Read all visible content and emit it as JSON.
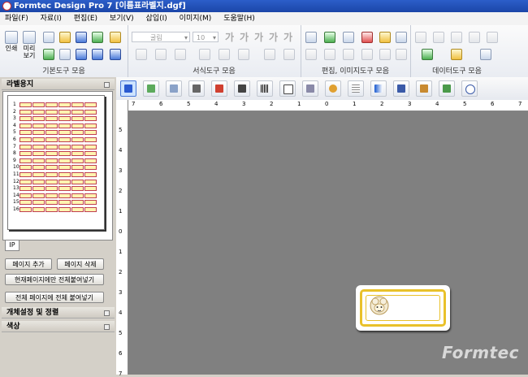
{
  "window": {
    "title": "Formtec Design Pro 7 [이름표라벨지.dgf]"
  },
  "menu": [
    "파일(F)",
    "자료(I)",
    "편집(E)",
    "보기(V)",
    "삽입(I)",
    "이미지(M)",
    "도움말(H)"
  ],
  "ribbon": {
    "groups": {
      "basic": "기본도구 모음",
      "format": "서식도구 모음",
      "edit": "편집, 이미지도구 모음",
      "data": "데이터도구 모음"
    },
    "print_label": "인쇄",
    "preview_label_1": "미리",
    "preview_label_2": "보기",
    "font_combo": "굴림",
    "size_combo": "10",
    "format_glyphs": [
      "가",
      "가",
      "가",
      "가",
      "가"
    ]
  },
  "left_panel": {
    "title": "라벨용지",
    "page_tab": "IP",
    "row_numbers": [
      "1",
      "2",
      "3",
      "4",
      "5",
      "6",
      "7",
      "8",
      "9",
      "10",
      "11",
      "12",
      "13",
      "14",
      "15",
      "16"
    ],
    "buttons": {
      "add_page": "페이지 추가",
      "delete_page": "페이지 삭제",
      "paste_current": "현재페이지에만 전체붙여넣기",
      "paste_all": "전체 페이지에 전체 붙여넣기"
    },
    "sections": {
      "object_settings": "개체설정 및 정렬",
      "color": "색상"
    }
  },
  "rulers": {
    "horizontal": [
      "7",
      "6",
      "5",
      "4",
      "3",
      "2",
      "1",
      "0",
      "1",
      "2",
      "3",
      "4",
      "5",
      "6",
      "7"
    ],
    "vertical": [
      "5",
      "4",
      "3",
      "2",
      "1",
      "0",
      "1",
      "2",
      "3",
      "4",
      "5",
      "6",
      "7"
    ]
  },
  "watermark": "Formtec"
}
